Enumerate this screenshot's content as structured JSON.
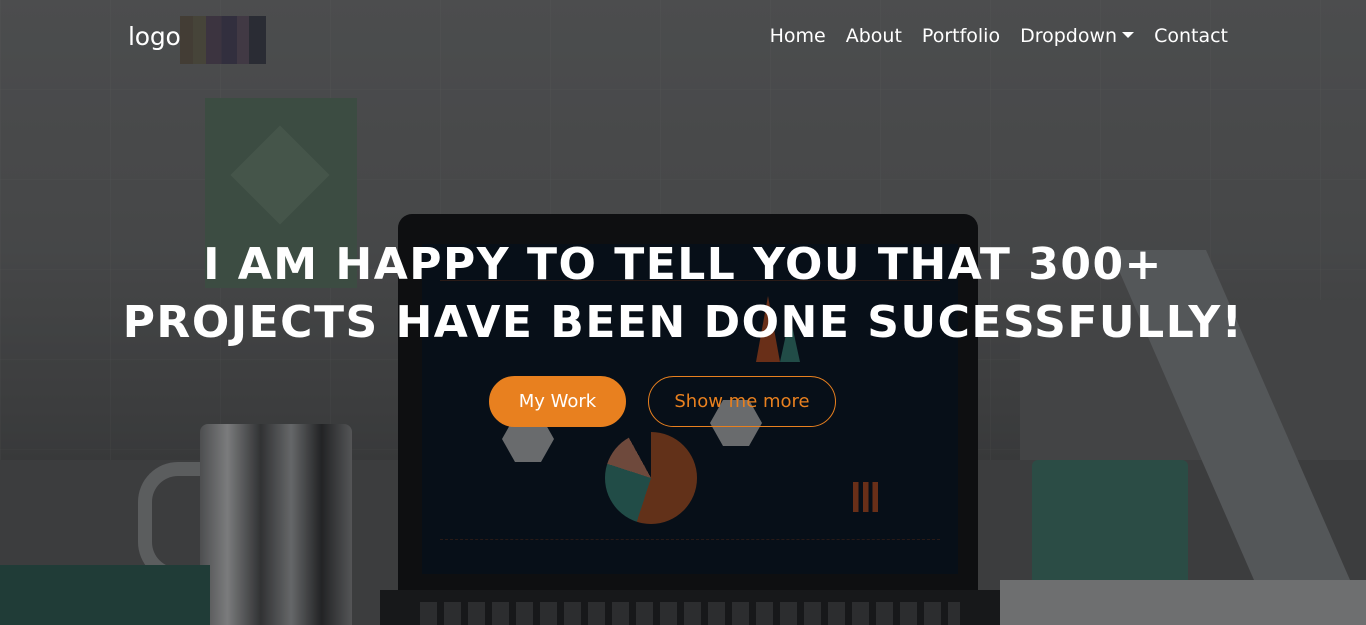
{
  "navbar": {
    "logo": "logo",
    "links": [
      "Home",
      "About",
      "Portfolio",
      "Dropdown",
      "Contact"
    ]
  },
  "hero": {
    "headline_line1": "I AM HAPPY TO TELL YOU THAT 300+",
    "headline_line2": "PROJECTS HAVE BEEN DONE SUCESSFULLY!",
    "primary_button": "My Work",
    "secondary_button": "Show me more"
  },
  "colors": {
    "accent": "#e8801f",
    "text": "#ffffff",
    "overlay": "rgba(0,0,0,0.45)"
  }
}
